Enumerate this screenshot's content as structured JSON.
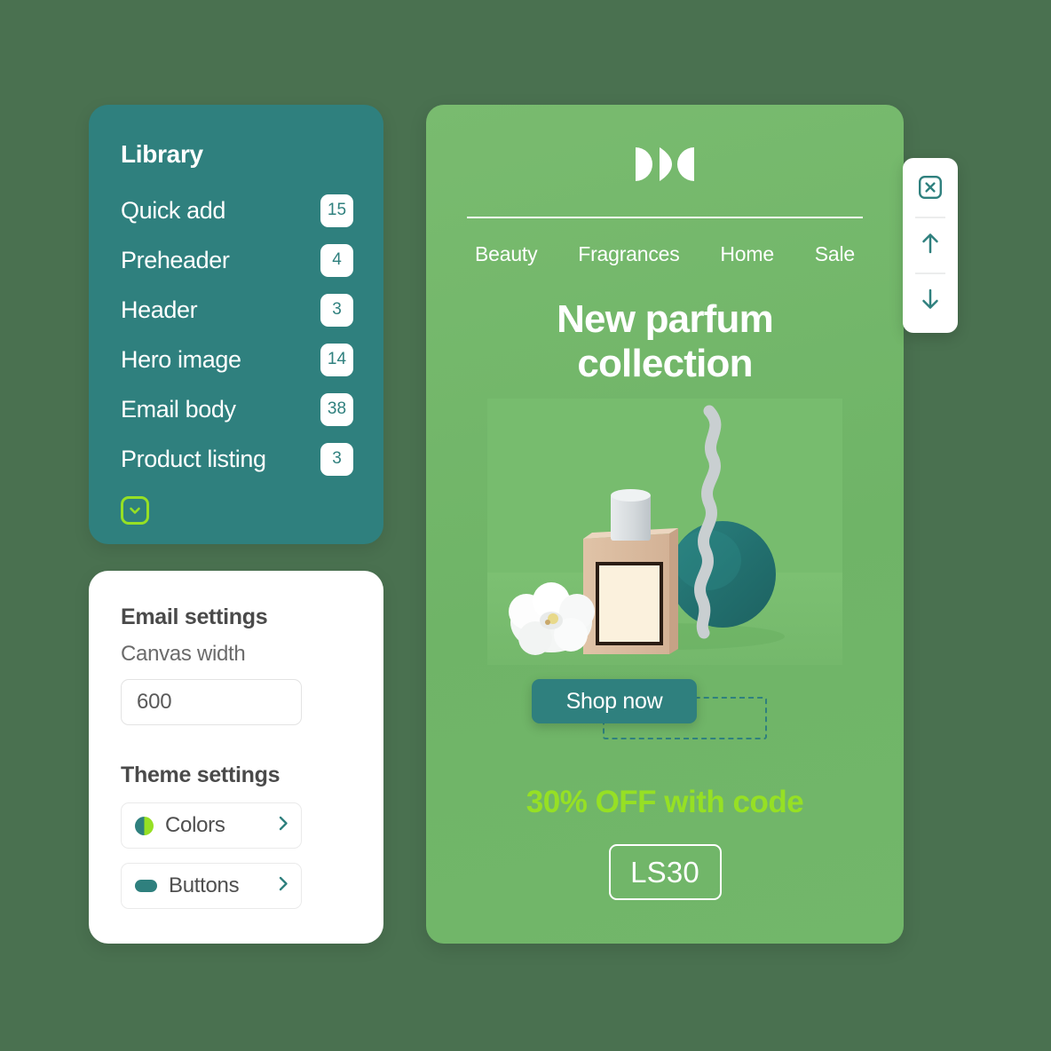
{
  "colors": {
    "page_background": "#4a7150",
    "panel_teal": "#2f807e",
    "accent_lime": "#96e024",
    "email_green": "#74b86b",
    "white": "#ffffff"
  },
  "library": {
    "title": "Library",
    "items": [
      {
        "label": "Quick add",
        "count": "15"
      },
      {
        "label": "Preheader",
        "count": "4"
      },
      {
        "label": "Header",
        "count": "3"
      },
      {
        "label": "Hero image",
        "count": "14"
      },
      {
        "label": "Email body",
        "count": "38"
      },
      {
        "label": "Product listing",
        "count": "3"
      }
    ],
    "expand_icon": "chevron-down-icon"
  },
  "settings": {
    "email_heading": "Email settings",
    "canvas_width_label": "Canvas width",
    "canvas_width_value": "600",
    "canvas_width_placeholder": "600",
    "theme_heading": "Theme settings",
    "theme_rows": [
      {
        "label": "Colors",
        "icon": "color-split-circle-icon"
      },
      {
        "label": "Buttons",
        "icon": "button-pill-icon"
      }
    ]
  },
  "email": {
    "logo_name": "brand-logo",
    "nav": [
      {
        "label": "Beauty"
      },
      {
        "label": "Fragrances"
      },
      {
        "label": "Home"
      },
      {
        "label": "Sale"
      }
    ],
    "headline_line1": "New parfum",
    "headline_line2": "collection",
    "cta_label": "Shop now",
    "promo_text": "30% OFF with code",
    "promo_code": "LS30"
  },
  "toolbar": {
    "items": [
      {
        "name": "delete-button",
        "icon": "close-box-icon"
      },
      {
        "name": "move-up-button",
        "icon": "arrow-up-icon"
      },
      {
        "name": "move-down-button",
        "icon": "arrow-down-icon"
      }
    ]
  }
}
